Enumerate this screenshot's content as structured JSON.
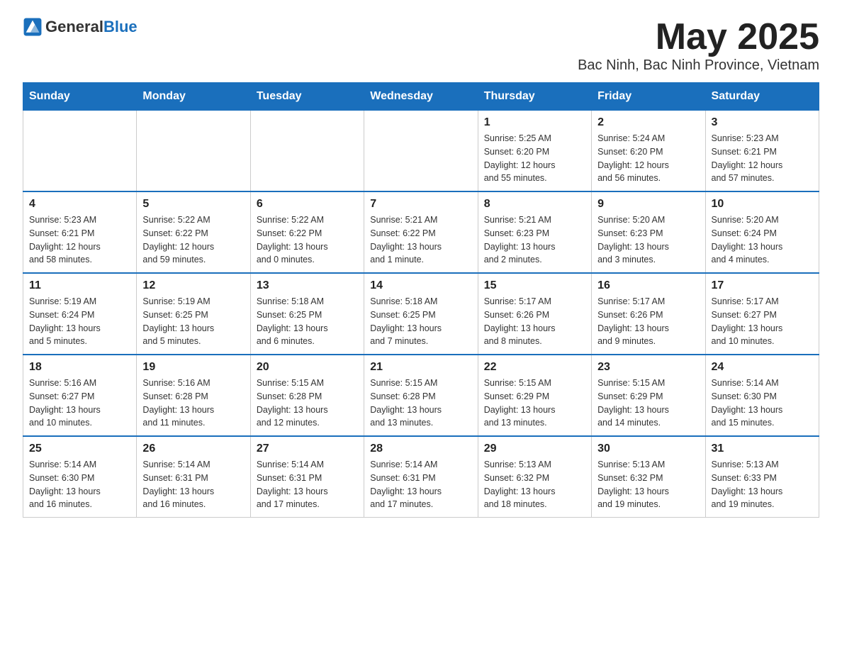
{
  "header": {
    "logo_general": "General",
    "logo_blue": "Blue",
    "month_year": "May 2025",
    "location": "Bac Ninh, Bac Ninh Province, Vietnam"
  },
  "weekdays": [
    "Sunday",
    "Monday",
    "Tuesday",
    "Wednesday",
    "Thursday",
    "Friday",
    "Saturday"
  ],
  "weeks": [
    [
      {
        "day": "",
        "info": ""
      },
      {
        "day": "",
        "info": ""
      },
      {
        "day": "",
        "info": ""
      },
      {
        "day": "",
        "info": ""
      },
      {
        "day": "1",
        "info": "Sunrise: 5:25 AM\nSunset: 6:20 PM\nDaylight: 12 hours\nand 55 minutes."
      },
      {
        "day": "2",
        "info": "Sunrise: 5:24 AM\nSunset: 6:20 PM\nDaylight: 12 hours\nand 56 minutes."
      },
      {
        "day": "3",
        "info": "Sunrise: 5:23 AM\nSunset: 6:21 PM\nDaylight: 12 hours\nand 57 minutes."
      }
    ],
    [
      {
        "day": "4",
        "info": "Sunrise: 5:23 AM\nSunset: 6:21 PM\nDaylight: 12 hours\nand 58 minutes."
      },
      {
        "day": "5",
        "info": "Sunrise: 5:22 AM\nSunset: 6:22 PM\nDaylight: 12 hours\nand 59 minutes."
      },
      {
        "day": "6",
        "info": "Sunrise: 5:22 AM\nSunset: 6:22 PM\nDaylight: 13 hours\nand 0 minutes."
      },
      {
        "day": "7",
        "info": "Sunrise: 5:21 AM\nSunset: 6:22 PM\nDaylight: 13 hours\nand 1 minute."
      },
      {
        "day": "8",
        "info": "Sunrise: 5:21 AM\nSunset: 6:23 PM\nDaylight: 13 hours\nand 2 minutes."
      },
      {
        "day": "9",
        "info": "Sunrise: 5:20 AM\nSunset: 6:23 PM\nDaylight: 13 hours\nand 3 minutes."
      },
      {
        "day": "10",
        "info": "Sunrise: 5:20 AM\nSunset: 6:24 PM\nDaylight: 13 hours\nand 4 minutes."
      }
    ],
    [
      {
        "day": "11",
        "info": "Sunrise: 5:19 AM\nSunset: 6:24 PM\nDaylight: 13 hours\nand 5 minutes."
      },
      {
        "day": "12",
        "info": "Sunrise: 5:19 AM\nSunset: 6:25 PM\nDaylight: 13 hours\nand 5 minutes."
      },
      {
        "day": "13",
        "info": "Sunrise: 5:18 AM\nSunset: 6:25 PM\nDaylight: 13 hours\nand 6 minutes."
      },
      {
        "day": "14",
        "info": "Sunrise: 5:18 AM\nSunset: 6:25 PM\nDaylight: 13 hours\nand 7 minutes."
      },
      {
        "day": "15",
        "info": "Sunrise: 5:17 AM\nSunset: 6:26 PM\nDaylight: 13 hours\nand 8 minutes."
      },
      {
        "day": "16",
        "info": "Sunrise: 5:17 AM\nSunset: 6:26 PM\nDaylight: 13 hours\nand 9 minutes."
      },
      {
        "day": "17",
        "info": "Sunrise: 5:17 AM\nSunset: 6:27 PM\nDaylight: 13 hours\nand 10 minutes."
      }
    ],
    [
      {
        "day": "18",
        "info": "Sunrise: 5:16 AM\nSunset: 6:27 PM\nDaylight: 13 hours\nand 10 minutes."
      },
      {
        "day": "19",
        "info": "Sunrise: 5:16 AM\nSunset: 6:28 PM\nDaylight: 13 hours\nand 11 minutes."
      },
      {
        "day": "20",
        "info": "Sunrise: 5:15 AM\nSunset: 6:28 PM\nDaylight: 13 hours\nand 12 minutes."
      },
      {
        "day": "21",
        "info": "Sunrise: 5:15 AM\nSunset: 6:28 PM\nDaylight: 13 hours\nand 13 minutes."
      },
      {
        "day": "22",
        "info": "Sunrise: 5:15 AM\nSunset: 6:29 PM\nDaylight: 13 hours\nand 13 minutes."
      },
      {
        "day": "23",
        "info": "Sunrise: 5:15 AM\nSunset: 6:29 PM\nDaylight: 13 hours\nand 14 minutes."
      },
      {
        "day": "24",
        "info": "Sunrise: 5:14 AM\nSunset: 6:30 PM\nDaylight: 13 hours\nand 15 minutes."
      }
    ],
    [
      {
        "day": "25",
        "info": "Sunrise: 5:14 AM\nSunset: 6:30 PM\nDaylight: 13 hours\nand 16 minutes."
      },
      {
        "day": "26",
        "info": "Sunrise: 5:14 AM\nSunset: 6:31 PM\nDaylight: 13 hours\nand 16 minutes."
      },
      {
        "day": "27",
        "info": "Sunrise: 5:14 AM\nSunset: 6:31 PM\nDaylight: 13 hours\nand 17 minutes."
      },
      {
        "day": "28",
        "info": "Sunrise: 5:14 AM\nSunset: 6:31 PM\nDaylight: 13 hours\nand 17 minutes."
      },
      {
        "day": "29",
        "info": "Sunrise: 5:13 AM\nSunset: 6:32 PM\nDaylight: 13 hours\nand 18 minutes."
      },
      {
        "day": "30",
        "info": "Sunrise: 5:13 AM\nSunset: 6:32 PM\nDaylight: 13 hours\nand 19 minutes."
      },
      {
        "day": "31",
        "info": "Sunrise: 5:13 AM\nSunset: 6:33 PM\nDaylight: 13 hours\nand 19 minutes."
      }
    ]
  ]
}
